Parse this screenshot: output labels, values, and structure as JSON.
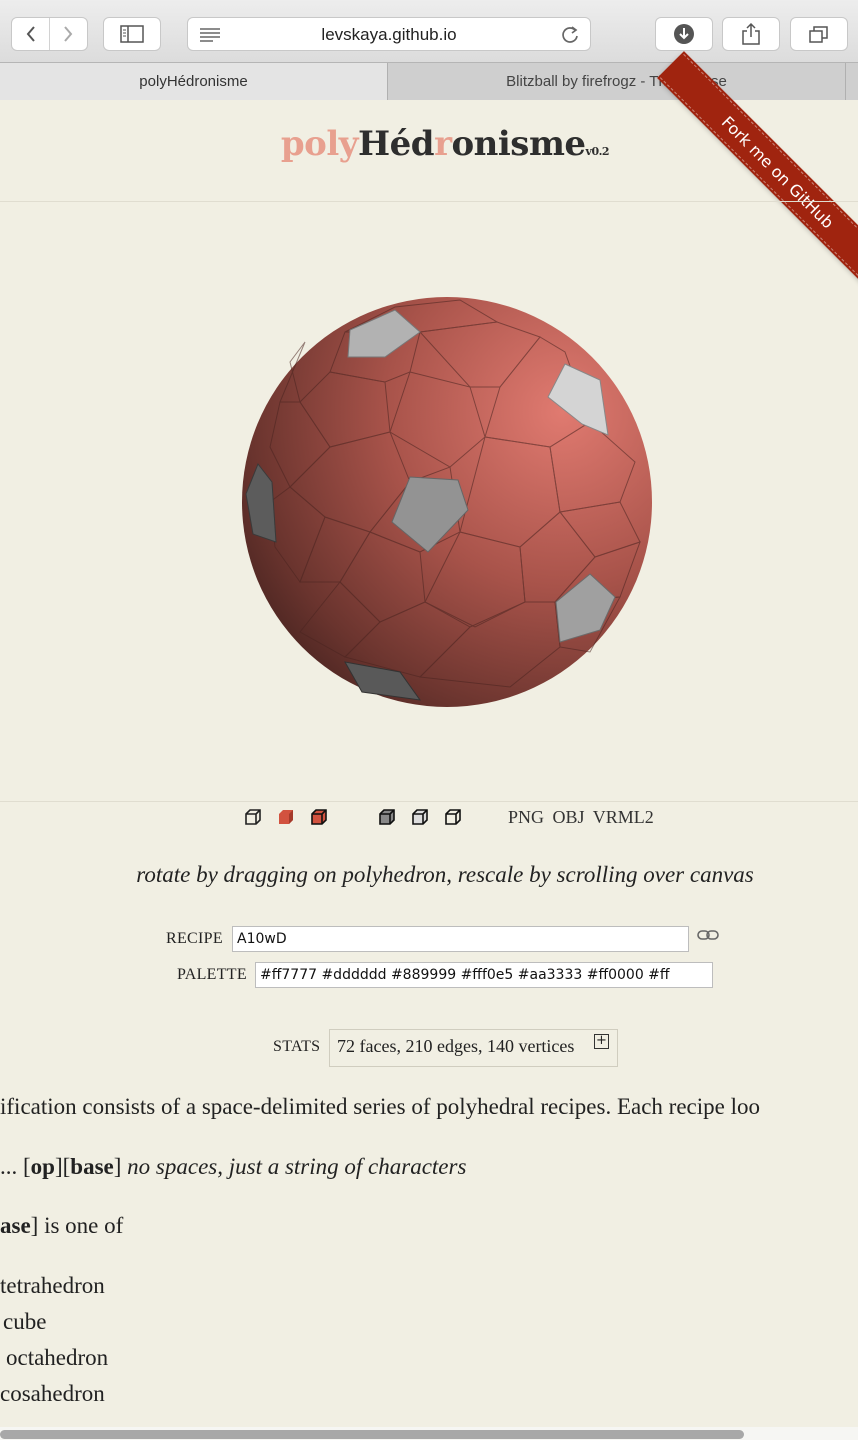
{
  "browser": {
    "url": "levskaya.github.io",
    "tabs": [
      "polyHédronisme",
      "Blitzball by firefrogz - Thingiverse"
    ]
  },
  "header": {
    "title_parts": [
      "poly",
      "Héd",
      "r",
      "onisme"
    ],
    "version": "v0.2",
    "ribbon": "Fork me on GitHub"
  },
  "polyhedron": {
    "colors": {
      "red": "#ff7777",
      "light_grey": "#dddddd",
      "grey": "#889999",
      "background": "#f1efe3"
    }
  },
  "toolbar_icons": [
    "wireframe-cube-icon",
    "solid-cube-icon",
    "outlined-red-cube-icon",
    "shaded-cube-icon",
    "flat-cube-icon",
    "outline-cube-icon"
  ],
  "exports": [
    "PNG",
    "OBJ",
    "VRML2"
  ],
  "hint": "rotate by dragging on polyhedron, rescale by scrolling over canvas",
  "recipe": {
    "label": "RECIPE",
    "value": "A10wD"
  },
  "palette": {
    "label": "PALETTE",
    "value": "#ff7777 #dddddd #889999 #fff0e5 #aa3333 #ff0000 #ff"
  },
  "stats": {
    "label": "STATS",
    "value": "72 faces, 210 edges, 140 vertices"
  },
  "doc": {
    "line1": "ification consists of a space-delimited series of polyhedral recipes. Each recipe loo",
    "line2_prefix": "... [",
    "op": "op",
    "base": "base",
    "line2_suffix": "no spaces, just a string of characters",
    "line3_bold": "ase",
    "line3_rest": "] is one of",
    "bases": [
      "tetrahedron",
      "cube",
      "octahedron",
      "cosahedron"
    ]
  }
}
